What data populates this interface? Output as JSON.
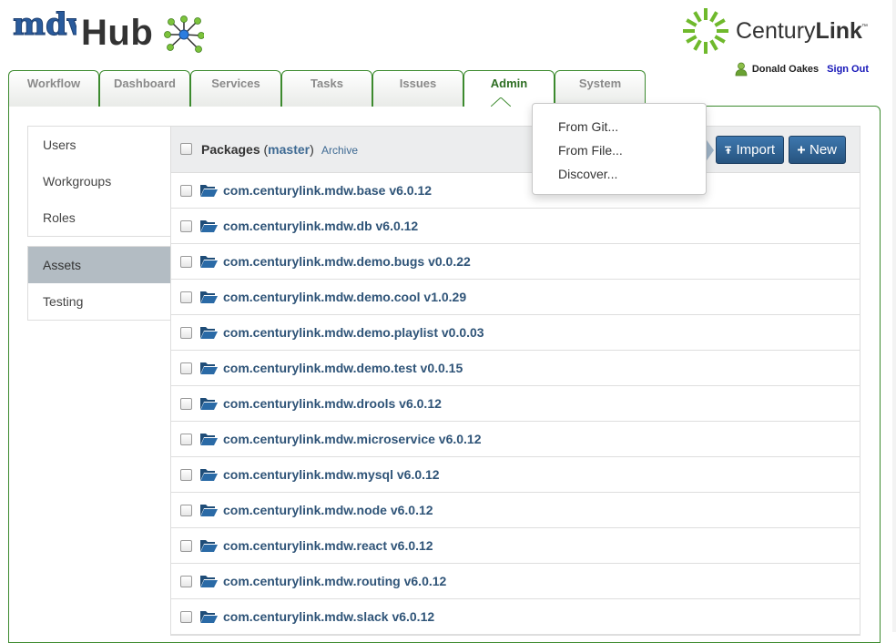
{
  "header": {
    "logo_text": "mdw",
    "title": "Hub",
    "brand": {
      "prefix": "Century",
      "suffix": "Link",
      "tm": "™"
    },
    "user": {
      "name": "Donald Oakes",
      "signout_label": "Sign Out"
    }
  },
  "tabs": [
    {
      "label": "Workflow",
      "active": false
    },
    {
      "label": "Dashboard",
      "active": false
    },
    {
      "label": "Services",
      "active": false
    },
    {
      "label": "Tasks",
      "active": false
    },
    {
      "label": "Issues",
      "active": false
    },
    {
      "label": "Admin",
      "active": true
    },
    {
      "label": "System",
      "active": false
    }
  ],
  "sidebar": {
    "group1": [
      {
        "label": "Users"
      },
      {
        "label": "Workgroups"
      },
      {
        "label": "Roles"
      }
    ],
    "group2": [
      {
        "label": "Assets",
        "active": true
      },
      {
        "label": "Testing"
      }
    ]
  },
  "packages": {
    "title": "Packages",
    "branch_open": "(",
    "branch": "master",
    "branch_close": ")",
    "archive_label": "Archive",
    "import_label": "Import",
    "new_label": "New",
    "items": [
      {
        "name": "com.centurylink.mdw.base v6.0.12"
      },
      {
        "name": "com.centurylink.mdw.db v6.0.12"
      },
      {
        "name": "com.centurylink.mdw.demo.bugs v0.0.22"
      },
      {
        "name": "com.centurylink.mdw.demo.cool v1.0.29"
      },
      {
        "name": "com.centurylink.mdw.demo.playlist v0.0.03"
      },
      {
        "name": "com.centurylink.mdw.demo.test v0.0.15"
      },
      {
        "name": "com.centurylink.mdw.drools v6.0.12"
      },
      {
        "name": "com.centurylink.mdw.microservice v6.0.12"
      },
      {
        "name": "com.centurylink.mdw.mysql v6.0.12"
      },
      {
        "name": "com.centurylink.mdw.node v6.0.12"
      },
      {
        "name": "com.centurylink.mdw.react v6.0.12"
      },
      {
        "name": "com.centurylink.mdw.routing v6.0.12"
      },
      {
        "name": "com.centurylink.mdw.slack v6.0.12"
      }
    ]
  },
  "import_menu": {
    "items": [
      {
        "label": "From Git..."
      },
      {
        "label": "From File..."
      },
      {
        "label": "Discover..."
      }
    ]
  },
  "colors": {
    "tab_border": "#3c8a2e",
    "active_tab_text": "#2e6e23",
    "link_blue": "#3e6a93",
    "package_text": "#2f5478",
    "button_blue": "#2f5f8f",
    "nav_active_bg": "#b3bcc3",
    "signout": "#1515b8",
    "brand_green": "#6fb92c"
  },
  "icons": {
    "logo": "mdw-logo",
    "network": "network-node-icon",
    "brand": "centurylink-logo",
    "user": "user-icon",
    "folder": "folder-open-icon",
    "import": "upload-icon",
    "new": "plus-icon"
  }
}
